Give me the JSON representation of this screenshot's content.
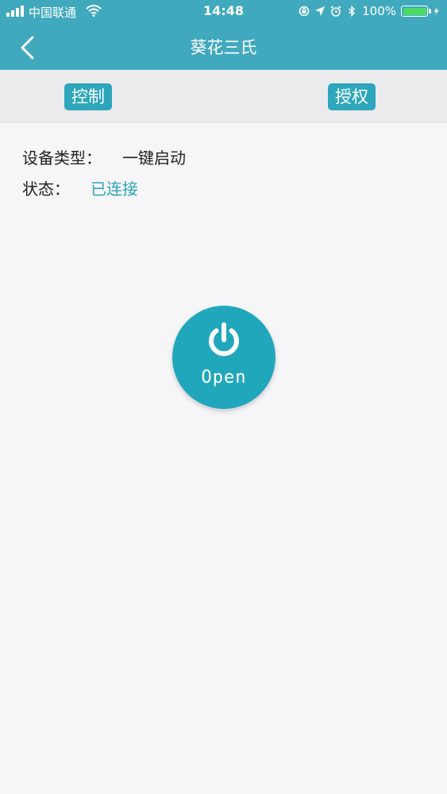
{
  "status_bar": {
    "carrier": "中国联通",
    "time": "14:48",
    "battery_text": "100%",
    "battery_level": 1.0,
    "battery_color": "#4cd964"
  },
  "nav": {
    "title": "葵花三氏",
    "back_icon": "chevron-left-icon"
  },
  "tabs": [
    {
      "label": "控制"
    },
    {
      "label": "授权"
    }
  ],
  "info": {
    "type_label": "设备类型：",
    "type_value": "一键启动",
    "status_label": "状态：",
    "status_value": "已连接"
  },
  "power_button": {
    "icon": "power-icon",
    "label": "Open"
  },
  "colors": {
    "header": "#41a9bd",
    "accent": "#21a7bb",
    "status_text": "#2aa3b7",
    "background": "#f6f6f8"
  }
}
